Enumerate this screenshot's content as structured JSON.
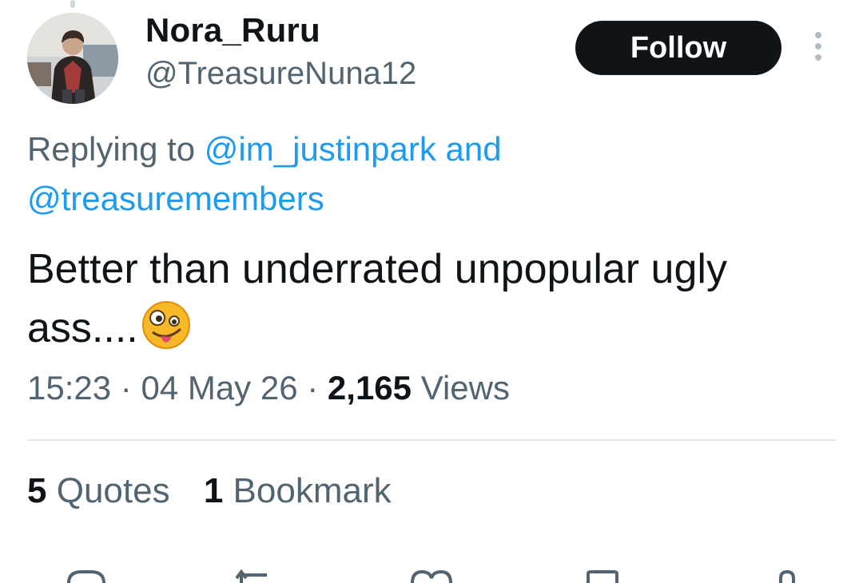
{
  "tweet": {
    "display_name": "Nora_Ruru",
    "handle": "@TreasureNuna12",
    "follow_label": "Follow",
    "replying_prefix": "Replying to",
    "reply_to_1": "@im_justinpark",
    "reply_and": "and",
    "reply_to_2": "@treasuremembers",
    "text": "Better than underrated unpopular ugly ass....",
    "emoji_icon": "zany-face-emoji",
    "time": "15:23",
    "separator": "·",
    "date": "04 May 26",
    "views_count": "2,165",
    "views_label": "Views"
  },
  "stats": {
    "quotes_count": "5",
    "quotes_label": "Quotes",
    "bookmarks_count": "1",
    "bookmarks_label": "Bookmark"
  },
  "actions": [
    "reply-icon",
    "retweet-icon",
    "like-icon",
    "bookmark-icon",
    "share-icon"
  ],
  "colors": {
    "link": "#1d9bf0",
    "secondary_text": "#536471",
    "primary_text": "#0f1419",
    "follow_bg": "#0f1419"
  }
}
